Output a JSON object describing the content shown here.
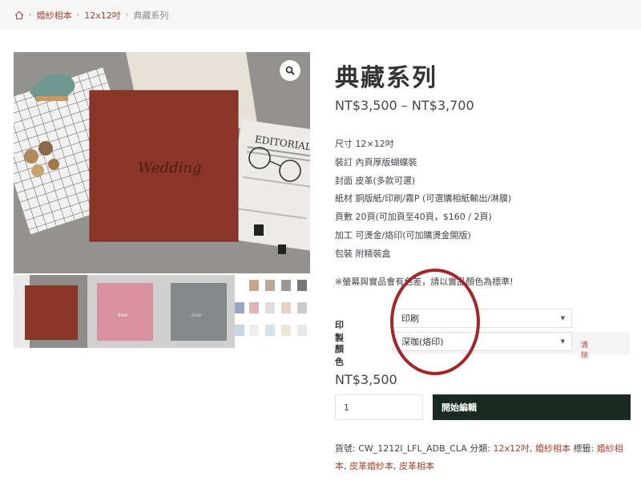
{
  "breadcrumb": {
    "items": [
      "婚紗相本",
      "12x12吋"
    ],
    "current": "典藏系列"
  },
  "product": {
    "title": "典藏系列",
    "price_range": "NT$3,500 – NT$3,700",
    "main_image_text": "EDITORIAL",
    "image_logo_text": "Wedding",
    "specs": [
      "尺寸 12×12吋",
      "裝訂 內頁厚版蝴蝶裝",
      "封面 皮革(多款可選)",
      "紙材 銅版紙/印刷/霧P (可選購相紙輸出/淋膜)",
      "頁數 20頁(可加頁至40頁，$160 / 2頁)",
      "加工 可燙金/烙印(可加購燙金開版)",
      "包裝 附精裝盒"
    ],
    "notice": "※螢幕與實品會有色差，請以實品顏色為標準!"
  },
  "variations": {
    "print_label": "印製",
    "print_value": "印刷",
    "color_label": "顏色",
    "color_value": "深咖(烙印)",
    "clear_label": "清除"
  },
  "purchase": {
    "variant_price": "NT$3,500",
    "quantity": "1",
    "cart_button": "開始編輯"
  },
  "meta": {
    "sku_label": "貨號:",
    "sku": "CW_1212I_LFL_ADB_CLA",
    "category_label": "分類:",
    "categories": [
      "12x12吋",
      "婚紗相本"
    ],
    "tag_label": "標籤:",
    "tags": [
      "婚紗相本",
      "皮革婚紗本",
      "皮革相本"
    ]
  },
  "colors": {
    "accent": "#a8432c",
    "button": "#1a2a22",
    "highlight": "#a3262a",
    "album_brown": "#8b3528",
    "album_pink": "#d9919f",
    "album_gray": "#86898a"
  }
}
